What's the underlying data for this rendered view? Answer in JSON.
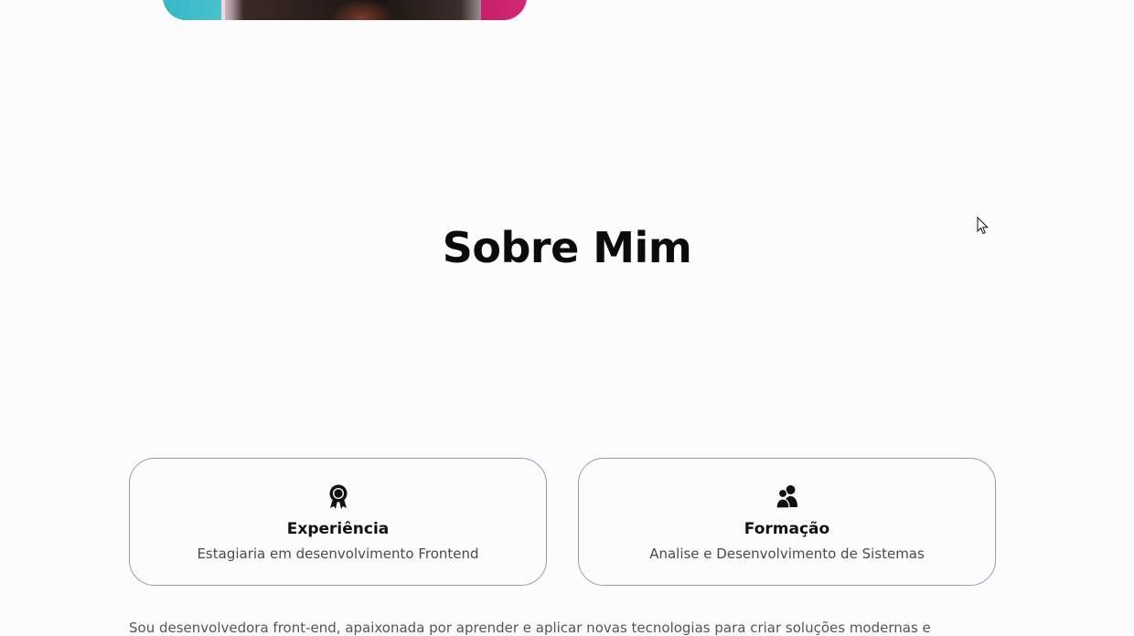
{
  "about": {
    "title": "Sobre Mim",
    "cards": [
      {
        "icon": "award-icon",
        "title": "Experiência",
        "text": "Estagiaria em desenvolvimento Frontend"
      },
      {
        "icon": "users-icon",
        "title": "Formação",
        "text": "Analise e Desenvolvimento de Sistemas"
      }
    ],
    "description": "Sou desenvolvedora front-end, apaixonada por aprender e aplicar novas tecnologias para criar soluções modernas e"
  },
  "colors": {
    "hero_cyan": "#35b9c7",
    "hero_magenta": "#c71f6a",
    "card_border": "#9a9aae"
  }
}
